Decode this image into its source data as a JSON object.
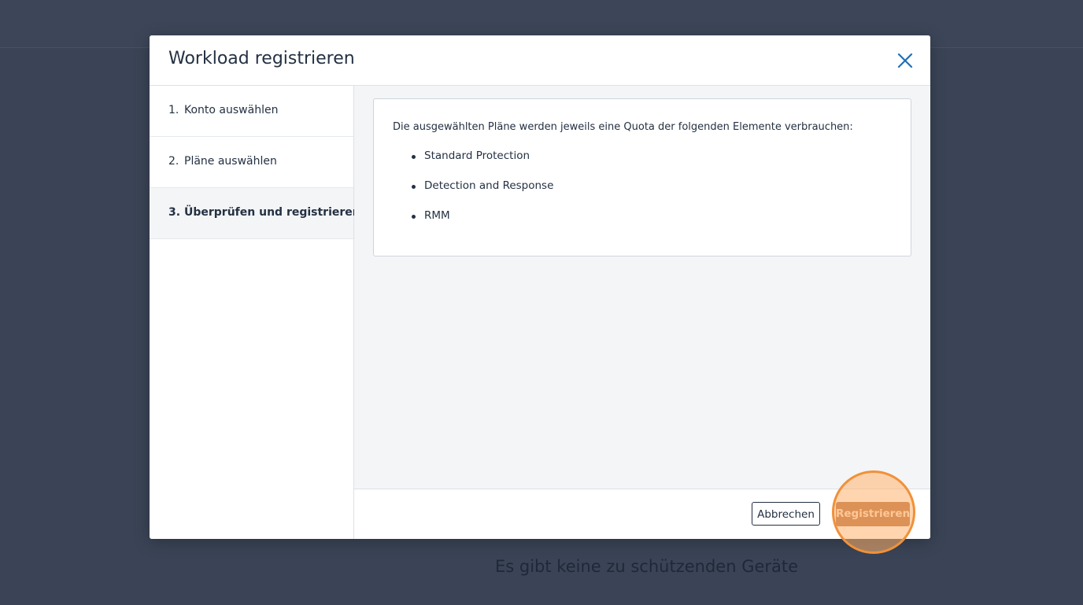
{
  "background": {
    "empty_text": "Es gibt keine zu schützenden Geräte"
  },
  "modal": {
    "title": "Workload registrieren",
    "close_icon": "close-icon",
    "steps": [
      {
        "num": "1.",
        "label": "Konto auswählen",
        "active": false
      },
      {
        "num": "2.",
        "label": "Pläne auswählen",
        "active": false
      },
      {
        "num": "3.",
        "label": "Überprüfen und registrieren",
        "active": true
      }
    ],
    "content": {
      "intro": "Die ausgewählten Pläne werden jeweils eine Quota der folgenden Elemente verbrauchen:",
      "items": [
        "Standard Protection",
        "Detection and Response",
        "RMM"
      ]
    },
    "footer": {
      "cancel_label": "Abbrechen",
      "register_label": "Registrieren"
    }
  },
  "colors": {
    "backdrop": "#3a4456",
    "accent": "#1f6fb5",
    "register_button": "#b26a3c",
    "highlight": "#f0913a"
  }
}
